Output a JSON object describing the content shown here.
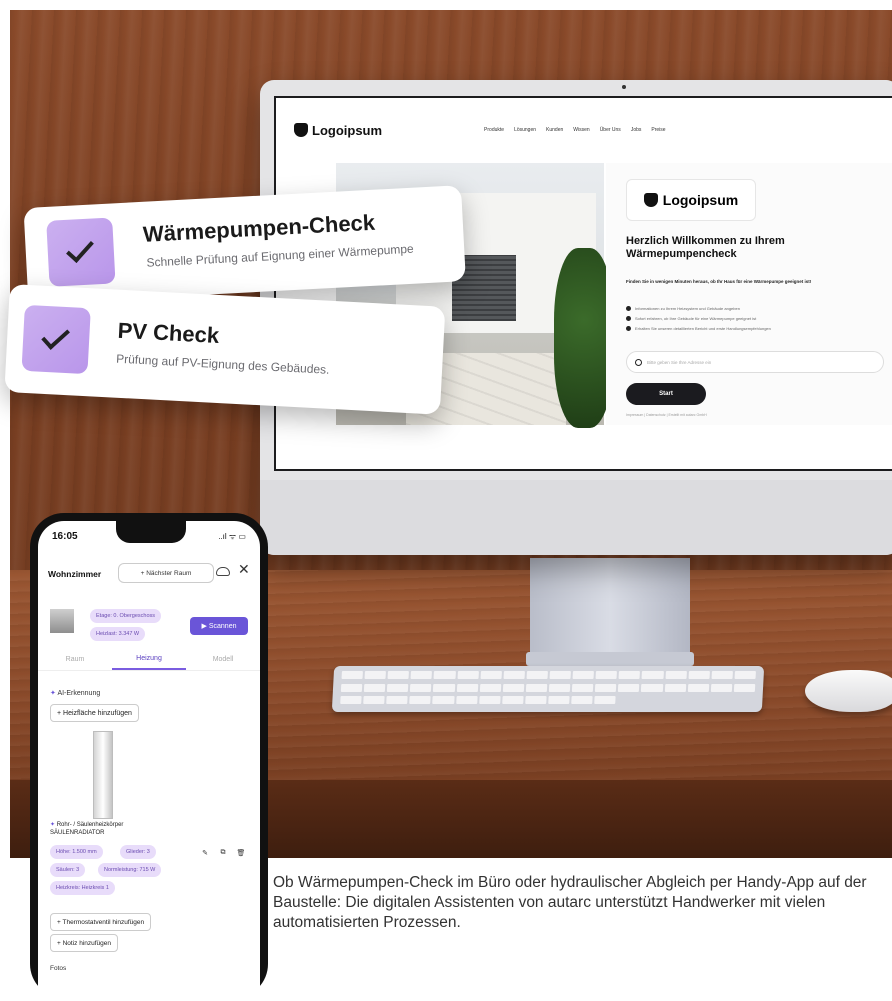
{
  "website": {
    "logo_text": "Logoipsum",
    "nav": [
      "Produkte",
      "Lösungen",
      "Kunden",
      "Wissen",
      "Über Uns",
      "Jobs",
      "Preise"
    ],
    "card_logo_text": "Logoipsum",
    "title": "Herzlich Willkommen zu Ihrem Wärmepumpencheck",
    "subtitle": "Finden Sie in wenigen Minuten heraus, ob Ihr Haus für eine Wärmepumpe geeignet ist!",
    "bullets": [
      "Informationen zu Ihrem Heizsystem und Gebäude angeben",
      "Sofort erfahren, ob Ihre Gebäude für eine Wärmepumpe geeignet ist",
      "Erhalten Sie unseren detaillierten Bericht und erste Handlungsempfehlungen"
    ],
    "search_placeholder": "Bitte geben Sie Ihre Adresse ein",
    "start_label": "Start",
    "legal": "Impressum | Datenschutz | Erstellt mit autarc GmbH"
  },
  "checks": [
    {
      "title": "Wärmepumpen-Check",
      "description": "Schnelle Prüfung auf Eignung einer Wärmepumpe"
    },
    {
      "title": "PV Check",
      "description": "Prüfung auf PV-Eignung des Gebäudes."
    }
  ],
  "phone": {
    "time": "16:05",
    "status_icons": "..ıl ᯤ ▭",
    "room_title": "Wohnzimmer",
    "next_room_label": "+ Nächster Raum",
    "pills": {
      "floor": "Etage: 0. Obergeschoss",
      "heating_load": "Heizlast: 3.347 W"
    },
    "scan_label": "▶ Scannen",
    "tabs": [
      "Raum",
      "Heizung",
      "Modell"
    ],
    "ai_label": "AI-Erkennung",
    "add_heating_label": "+ Heizfläche hinzufügen",
    "radiator_type": "Rohr- / Säulenheizkörper",
    "radiator_subtype": "SÄULENRADIATOR",
    "specs": [
      "Höhe: 1.500 mm",
      "Glieder: 3",
      "Säulen: 3",
      "Normleistung: 715 W",
      "Heizkreis: Heizkreis 1"
    ],
    "thermostat_label": "+ Thermostatventil hinzufügen",
    "note_label": "+ Notiz hinzufügen",
    "fotos_label": "Fotos"
  },
  "caption": "Ob Wärmepumpen-Check im Büro oder hydraulischer Abgleich per Handy-App auf der Baustelle: Die digitalen Assistenten von autarc unterstützt Handwerker mit vielen automatisierten Prozessen."
}
